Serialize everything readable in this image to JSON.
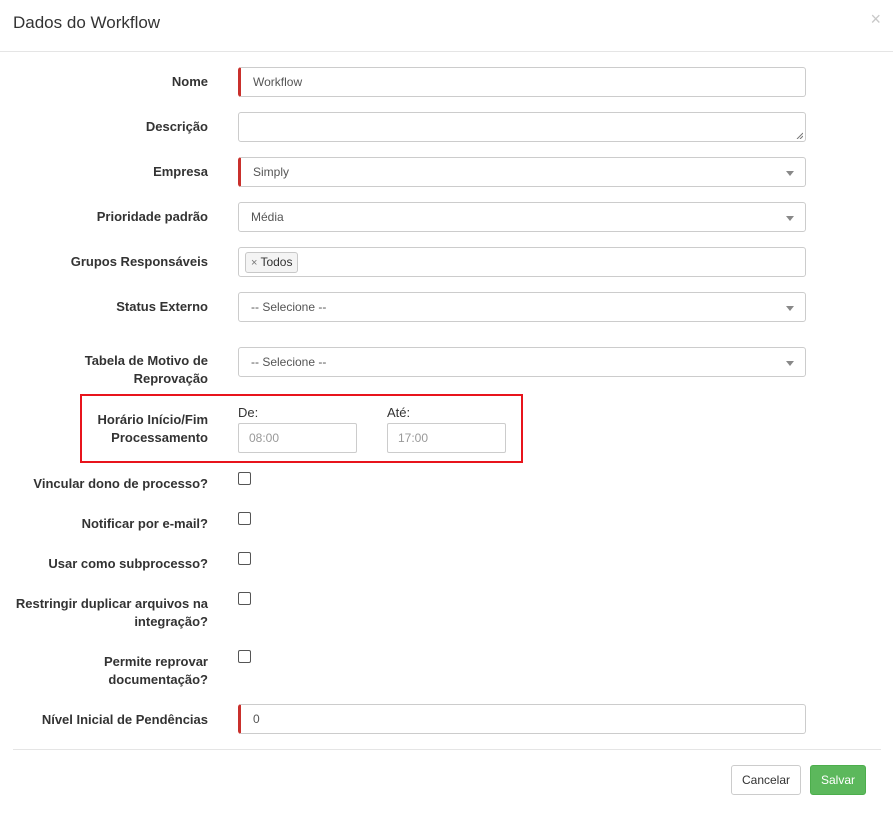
{
  "modal": {
    "title": "Dados do Workflow",
    "close_glyph": "×"
  },
  "fields": {
    "nome": {
      "label": "Nome",
      "value": "Workflow"
    },
    "descricao": {
      "label": "Descrição",
      "value": ""
    },
    "empresa": {
      "label": "Empresa",
      "value": "Simply"
    },
    "prioridade": {
      "label": "Prioridade padrão",
      "value": "Média"
    },
    "grupos": {
      "label": "Grupos Responsáveis",
      "tag_remove": "×",
      "tag_label": "Todos"
    },
    "status_externo": {
      "label": "Status Externo",
      "value": "-- Selecione --"
    },
    "motivo": {
      "label_line1": "Tabela de Motivo de",
      "label_line2": "Reprovação",
      "value": "-- Selecione --"
    },
    "horario": {
      "label_line1": "Horário Início/Fim",
      "label_line2": "Processamento",
      "de_label": "De:",
      "de_placeholder": "08:00",
      "ate_label": "Até:",
      "ate_placeholder": "17:00"
    },
    "vincular": {
      "label": "Vincular dono de processo?",
      "checked": false
    },
    "notificar": {
      "label": "Notificar por e-mail?",
      "checked": false
    },
    "subprocesso": {
      "label": "Usar como subprocesso?",
      "checked": false
    },
    "restringir": {
      "label_line1": "Restringir duplicar arquivos na",
      "label_line2": "integração?",
      "checked": false
    },
    "reprovar": {
      "label_line1": "Permite reprovar",
      "label_line2": "documentação?",
      "checked": false
    },
    "nivel": {
      "label": "Nível Inicial de Pendências",
      "value": "0"
    }
  },
  "footer": {
    "cancel_label": "Cancelar",
    "save_label": "Salvar"
  },
  "colors": {
    "required_marker": "#c9302c",
    "highlight_box": "#e8141c",
    "save_button": "#5cb85c"
  }
}
